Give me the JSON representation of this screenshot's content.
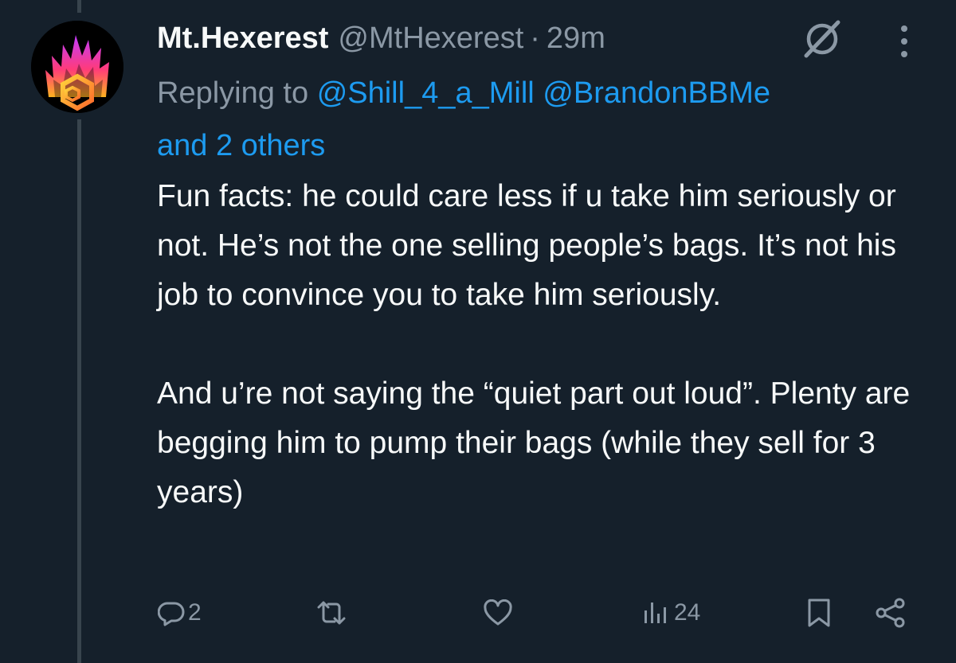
{
  "tweet": {
    "display_name": "Mt.Hexerest",
    "handle": "@MtHexerest",
    "separator": "·",
    "time": "29m",
    "replying_to_label": "Replying to",
    "mentions": [
      "@Shill_4_a_Mill",
      "@BrandonBBMe"
    ],
    "and_others": "and 2 others",
    "paragraphs": [
      "Fun facts: he could care less if u take him seriously or not. He’s not the one selling people’s bags. It’s not his job to convince you to take him seriously.",
      "And u’re not saying the “quiet part out loud”. Plenty are begging him to pump their bags (while they sell for 3 years)"
    ]
  },
  "actions": {
    "reply_count": "2",
    "retweet_count": "",
    "like_count": "",
    "views_count": "24"
  },
  "icons": {
    "avatar": "hex-flame-logo",
    "grok": "grok-icon",
    "more": "more-vertical-icon",
    "reply": "reply-icon",
    "retweet": "retweet-icon",
    "like": "heart-icon",
    "views": "views-icon",
    "bookmark": "bookmark-icon",
    "share": "share-icon"
  },
  "colors": {
    "background": "#15202b",
    "primary_text": "#f7f9f9",
    "secondary_text": "#8b98a5",
    "link": "#1d9bf0",
    "thread_line": "#38444d"
  }
}
